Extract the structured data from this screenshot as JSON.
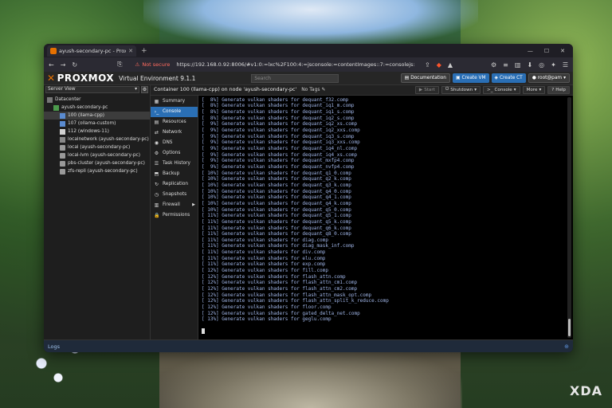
{
  "browser": {
    "tab_title": "ayush-secondary-pc - Proxmox",
    "new_tab": "+",
    "not_secure": "Not secure",
    "url": "https://192.168.0.92:8006/#v1:0:=lxc%2F100:4:=jsconsole:=contentImages::7:=consolejs:"
  },
  "pve": {
    "logo": "PROXMOX",
    "title": "Virtual Environment 9.1.1",
    "search_placeholder": "Search",
    "buttons": {
      "documentation": "Documentation",
      "create_vm": "Create VM",
      "create_ct": "Create CT",
      "user": "root@pam"
    },
    "view": "Server View",
    "tree": [
      {
        "label": "Datacenter",
        "icon": "dc",
        "indent": 0
      },
      {
        "label": "ayush-secondary-pc",
        "icon": "node",
        "indent": 1
      },
      {
        "label": "100 (llama-cpp)",
        "icon": "ct",
        "indent": 2,
        "selected": true
      },
      {
        "label": "107 (ollama-custom)",
        "icon": "ct",
        "indent": 2
      },
      {
        "label": "112 (windows-11)",
        "icon": "vm",
        "indent": 2
      },
      {
        "label": "localnetwork (ayush-secondary-pc)",
        "icon": "net",
        "indent": 2
      },
      {
        "label": "local (ayush-secondary-pc)",
        "icon": "store",
        "indent": 2
      },
      {
        "label": "local-lvm (ayush-secondary-pc)",
        "icon": "store",
        "indent": 2
      },
      {
        "label": "pbs-cluster (ayush-secondary-pc)",
        "icon": "store",
        "indent": 2
      },
      {
        "label": "zfs-repli (ayush-secondary-pc)",
        "icon": "store",
        "indent": 2
      }
    ],
    "container_title": "Container 100 (llama-cpp) on node 'ayush-secondary-pc'",
    "no_tags": "No Tags",
    "actions": {
      "start": "Start",
      "shutdown": "Shutdown",
      "console": "Console",
      "more": "More",
      "help": "Help"
    },
    "menu": [
      {
        "label": "Summary",
        "icon": "summary-icon"
      },
      {
        "label": "Console",
        "icon": "console-icon",
        "active": true
      },
      {
        "label": "Resources",
        "icon": "resources-icon"
      },
      {
        "label": "Network",
        "icon": "network-icon"
      },
      {
        "label": "DNS",
        "icon": "dns-icon"
      },
      {
        "label": "Options",
        "icon": "options-icon"
      },
      {
        "label": "Task History",
        "icon": "task-history-icon"
      },
      {
        "label": "Backup",
        "icon": "backup-icon"
      },
      {
        "label": "Replication",
        "icon": "replication-icon"
      },
      {
        "label": "Snapshots",
        "icon": "snapshots-icon"
      },
      {
        "label": "Firewall",
        "icon": "firewall-icon",
        "submenu": true
      },
      {
        "label": "Permissions",
        "icon": "permissions-icon"
      }
    ],
    "console_lines": [
      "[  8%] Generate vulkan shaders for dequant_f32.comp",
      "[  8%] Generate vulkan shaders for dequant_iq1_m.comp",
      "[  8%] Generate vulkan shaders for dequant_iq1_s.comp",
      "[  8%] Generate vulkan shaders for dequant_iq2_s.comp",
      "[  9%] Generate vulkan shaders for dequant_iq2_xs.comp",
      "[  9%] Generate vulkan shaders for dequant_iq2_xxs.comp",
      "[  9%] Generate vulkan shaders for dequant_iq3_s.comp",
      "[  9%] Generate vulkan shaders for dequant_iq3_xxs.comp",
      "[  9%] Generate vulkan shaders for dequant_iq4_nl.comp",
      "[  9%] Generate vulkan shaders for dequant_iq4_xs.comp",
      "[  9%] Generate vulkan shaders for dequant_mxfp4.comp",
      "[  9%] Generate vulkan shaders for dequant_nvfp4.comp",
      "[ 10%] Generate vulkan shaders for dequant_q1_0.comp",
      "[ 10%] Generate vulkan shaders for dequant_q2_k.comp",
      "[ 10%] Generate vulkan shaders for dequant_q3_k.comp",
      "[ 10%] Generate vulkan shaders for dequant_q4_0.comp",
      "[ 10%] Generate vulkan shaders for dequant_q4_1.comp",
      "[ 10%] Generate vulkan shaders for dequant_q4_k.comp",
      "[ 10%] Generate vulkan shaders for dequant_q5_0.comp",
      "[ 11%] Generate vulkan shaders for dequant_q5_1.comp",
      "[ 11%] Generate vulkan shaders for dequant_q5_k.comp",
      "[ 11%] Generate vulkan shaders for dequant_q6_k.comp",
      "[ 11%] Generate vulkan shaders for dequant_q8_0.comp",
      "[ 11%] Generate vulkan shaders for diag.comp",
      "[ 11%] Generate vulkan shaders for diag_mask_inf.comp",
      "[ 11%] Generate vulkan shaders for div.comp",
      "[ 11%] Generate vulkan shaders for elu.comp",
      "[ 11%] Generate vulkan shaders for exp.comp",
      "[ 12%] Generate vulkan shaders for fill.comp",
      "[ 12%] Generate vulkan shaders for flash_attn.comp",
      "[ 12%] Generate vulkan shaders for flash_attn_cm1.comp",
      "[ 12%] Generate vulkan shaders for flash_attn_cm2.comp",
      "[ 12%] Generate vulkan shaders for flash_attn_mask_opt.comp",
      "[ 12%] Generate vulkan shaders for flash_attn_split_k_reduce.comp",
      "[ 12%] Generate vulkan shaders for floor.comp",
      "[ 12%] Generate vulkan shaders for gated_delta_net.comp",
      "[ 13%] Generate vulkan shaders for geglu.comp"
    ],
    "logs": "Logs"
  },
  "watermark": "XDA"
}
